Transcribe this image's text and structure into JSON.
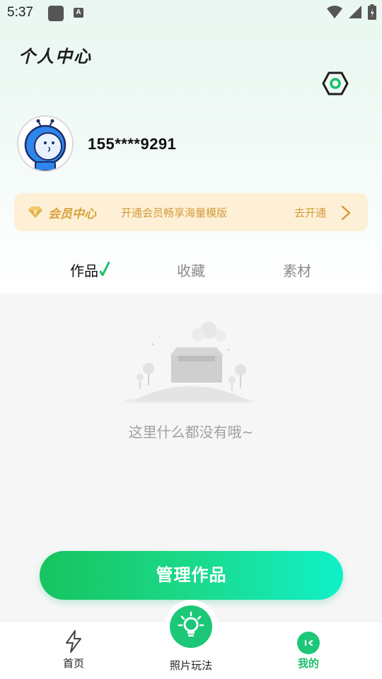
{
  "status_bar": {
    "time": "5:37",
    "a_badge": "A"
  },
  "header": {
    "title": "个人中心"
  },
  "user": {
    "phone": "155****9291"
  },
  "vip": {
    "title": "会员中心",
    "desc": "开通会员畅享海量模版",
    "open_label": "去开通",
    "accent": "#d9a23a"
  },
  "tabs": [
    {
      "label": "作品",
      "active": true
    },
    {
      "label": "收藏",
      "active": false
    },
    {
      "label": "素材",
      "active": false
    }
  ],
  "empty": {
    "text": "这里什么都没有哦~"
  },
  "manage_button": {
    "label": "管理作品"
  },
  "bottom_nav": {
    "items": [
      {
        "label": "首页",
        "icon": "lightning-icon",
        "active": false
      },
      {
        "label": "照片玩法",
        "icon": "lightbulb-icon",
        "active": false
      },
      {
        "label": "我的",
        "icon": "face-icon",
        "active": true
      }
    ],
    "active_color": "#19c06a"
  }
}
